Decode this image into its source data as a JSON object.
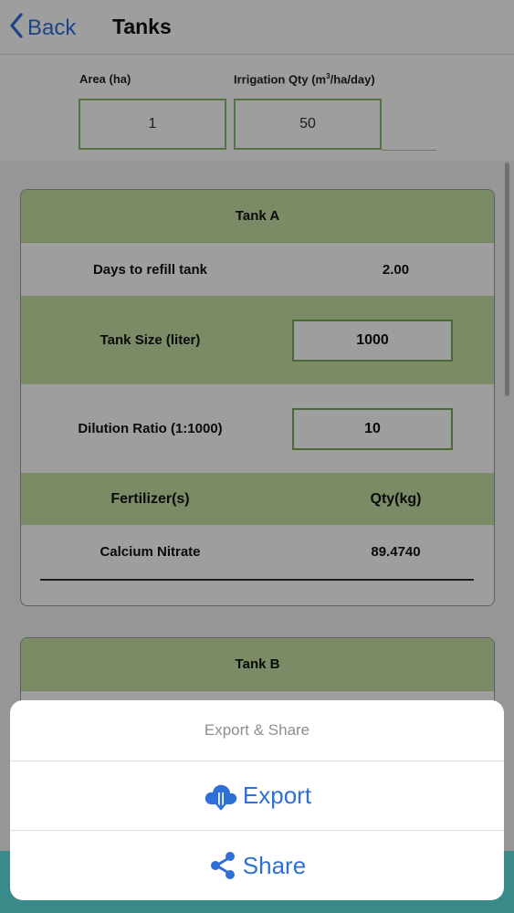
{
  "nav": {
    "back_label": "Back",
    "title": "Tanks"
  },
  "inputs": {
    "area_label": "Area (ha)",
    "irrigation_label_pre": "Irrigation Qty (m",
    "irrigation_label_sup": "3",
    "irrigation_label_post": "/ha/day)",
    "area_value": "1",
    "irrigation_value": "50"
  },
  "tank_a": {
    "title": "Tank A",
    "days_label": "Days to refill tank",
    "days_value": "2.00",
    "size_label": "Tank Size (liter)",
    "size_value": "1000",
    "dilution_label": "Dilution Ratio (1:1000)",
    "dilution_value": "10",
    "fert_header": "Fertilizer(s)",
    "qty_header": "Qty(kg)",
    "fertilizers": [
      {
        "name": "Calcium Nitrate",
        "qty": "89.4740"
      }
    ]
  },
  "tank_b": {
    "title": "Tank B"
  },
  "sheet": {
    "title": "Export & Share",
    "export_label": "Export",
    "share_label": "Share"
  },
  "colors": {
    "accent_blue": "#2f6fd8",
    "green_fill": "#c5e0a5",
    "green_border": "#7aa857"
  },
  "icons": {
    "back": "chevron-left-icon",
    "export": "cloud-download-icon",
    "share": "share-icon"
  }
}
